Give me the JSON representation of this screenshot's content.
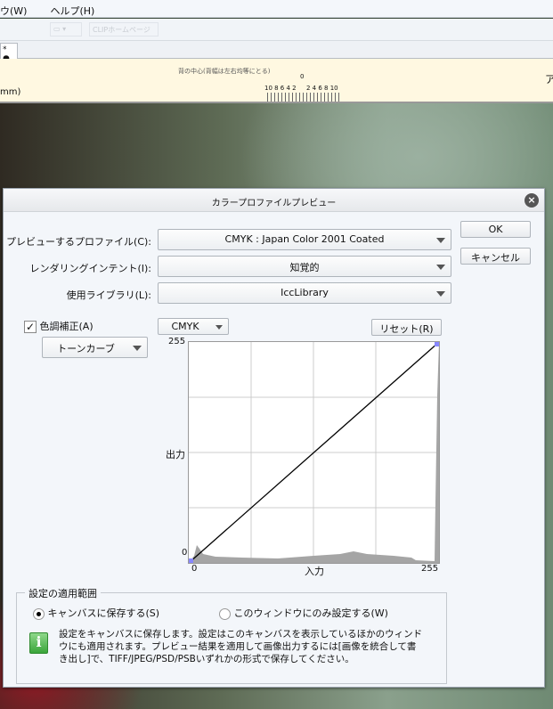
{
  "menu": {
    "items": [
      "ウ(W)",
      "ヘルプ(H)"
    ]
  },
  "toolbar": {
    "clip_home": "CLIPホームページ"
  },
  "tab": {
    "label": "* ●"
  },
  "ruler": {
    "caption": "背の中心(背幅は左右均等にとる)",
    "zero": "0",
    "left_ticks": "10 8 6 4 2",
    "right_ticks": "2 4 6 8 10",
    "unit": "mm)",
    "right_char": "ア"
  },
  "dialog": {
    "title": "カラープロファイルプレビュー",
    "ok": "OK",
    "cancel": "キャンセル",
    "profile_label": "プレビューするプロファイル(C):",
    "profile_value": "CMYK : Japan Color 2001 Coated",
    "intent_label": "レンダリングインテント(I):",
    "intent_value": "知覚的",
    "library_label": "使用ライブラリ(L):",
    "library_value": "IccLibrary",
    "tone_check_label": "色調補正(A)",
    "tone_checked": true,
    "tone_mode": "トーンカーブ",
    "channel": "CMYK",
    "reset": "リセット(R)",
    "graph": {
      "y_max": "255",
      "y_min": "0",
      "x_min": "0",
      "x_max": "255",
      "x_label": "入力",
      "y_label": "出力"
    },
    "scope": {
      "title": "設定の適用範囲",
      "option1": "キャンバスに保存する(S)",
      "option2": "このウィンドウにのみ設定する(W)",
      "selected": "option1",
      "info": "設定をキャンバスに保存します。設定はこのキャンバスを表示しているほかのウィンドウにも適用されます。プレビュー結果を適用して画像出力するには[画像を統合して書き出し]で、TIFF/JPEG/PSD/PSBいずれかの形式で保存してください。"
    }
  }
}
